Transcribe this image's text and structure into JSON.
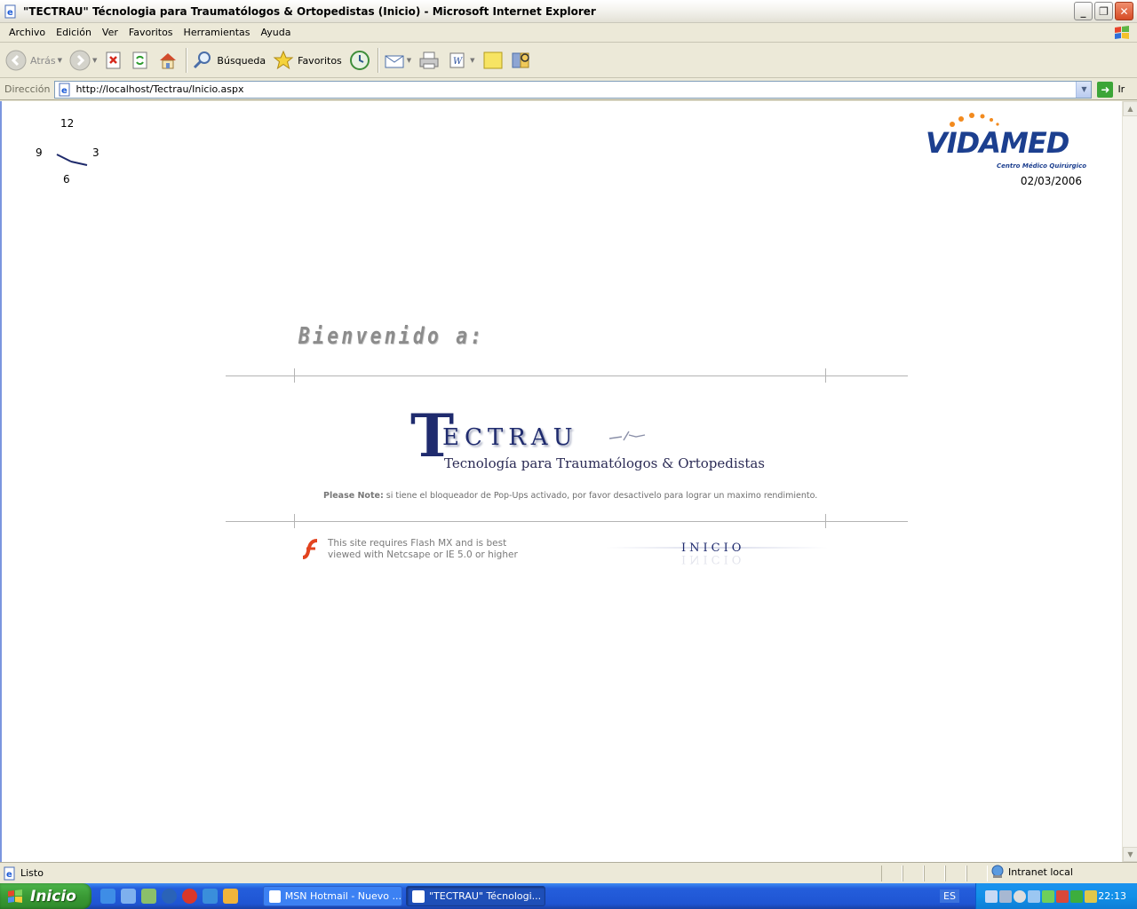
{
  "window": {
    "title": "\"TECTRAU\" Técnologia para Traumatólogos & Ortopedistas (Inicio) - Microsoft Internet Explorer",
    "minimize": "_",
    "maximize": "❐",
    "close": "✕"
  },
  "menu": [
    "Archivo",
    "Edición",
    "Ver",
    "Favoritos",
    "Herramientas",
    "Ayuda"
  ],
  "toolbar": {
    "back": "Atrás",
    "search": "Búsqueda",
    "favorites": "Favoritos"
  },
  "address": {
    "label": "Dirección",
    "url": "http://localhost/Tectrau/Inicio.aspx",
    "go": "Ir"
  },
  "page": {
    "clock": {
      "n12": "12",
      "n3": "3",
      "n6": "6",
      "n9": "9"
    },
    "logo": {
      "name": "VIDAMED",
      "tagline": "Centro Médico Quirúrgico"
    },
    "date": "02/03/2006",
    "welcome": "Bienvenido a:",
    "brand": {
      "initial": "T",
      "word": "ECTRAU",
      "subtitle": "Tecnología para Traumatólogos & Ortopedistas"
    },
    "note_label": "Please Note:",
    "note_text": " si tiene el bloqueador de Pop-Ups activado, por favor desactivelo para lograr un maximo rendimiento.",
    "flash_line1": "This site requires Flash MX and is best",
    "flash_line2": "viewed with Netcsape or IE 5.0 or higher",
    "enter": "INICIO"
  },
  "status": {
    "text": "Listo",
    "zone": "Intranet local"
  },
  "taskbar": {
    "start": "Inicio",
    "tasks": [
      "MSN Hotmail - Nuevo ...",
      "\"TECTRAU\" Técnologi..."
    ],
    "lang": "ES",
    "time": "22:13"
  }
}
